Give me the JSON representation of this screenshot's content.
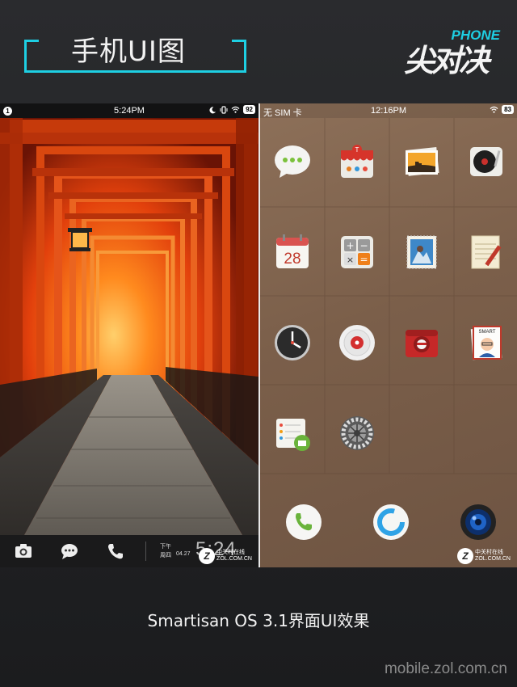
{
  "header": {
    "title": "手机UI图",
    "logo_main": "尖对决",
    "logo_sub": "PHONE"
  },
  "left_phone": {
    "status": {
      "left": "1",
      "time": "5:24PM",
      "battery": "92"
    },
    "lock_bar": {
      "period": "下午",
      "weekday": "周四",
      "date": "04.27",
      "time": "5:24"
    },
    "icons": [
      "camera-icon",
      "message-icon",
      "phone-icon"
    ]
  },
  "right_phone": {
    "status": {
      "carrier": "无 SIM 卡",
      "time": "12:16PM",
      "battery": "83"
    },
    "calendar_day": "28",
    "apps": [
      "messages",
      "app-store",
      "photos",
      "music",
      "calendar",
      "calculator",
      "mail",
      "notes",
      "clock",
      "recorder",
      "camera",
      "contacts",
      "reminders",
      "settings"
    ],
    "dock": [
      "phone",
      "browser",
      "camera"
    ]
  },
  "watermark": {
    "brand": "中关村在线",
    "url": "ZOL.COM.CN"
  },
  "caption": "Smartisan OS 3.1界面UI效果",
  "site": "mobile.zol.com.cn"
}
